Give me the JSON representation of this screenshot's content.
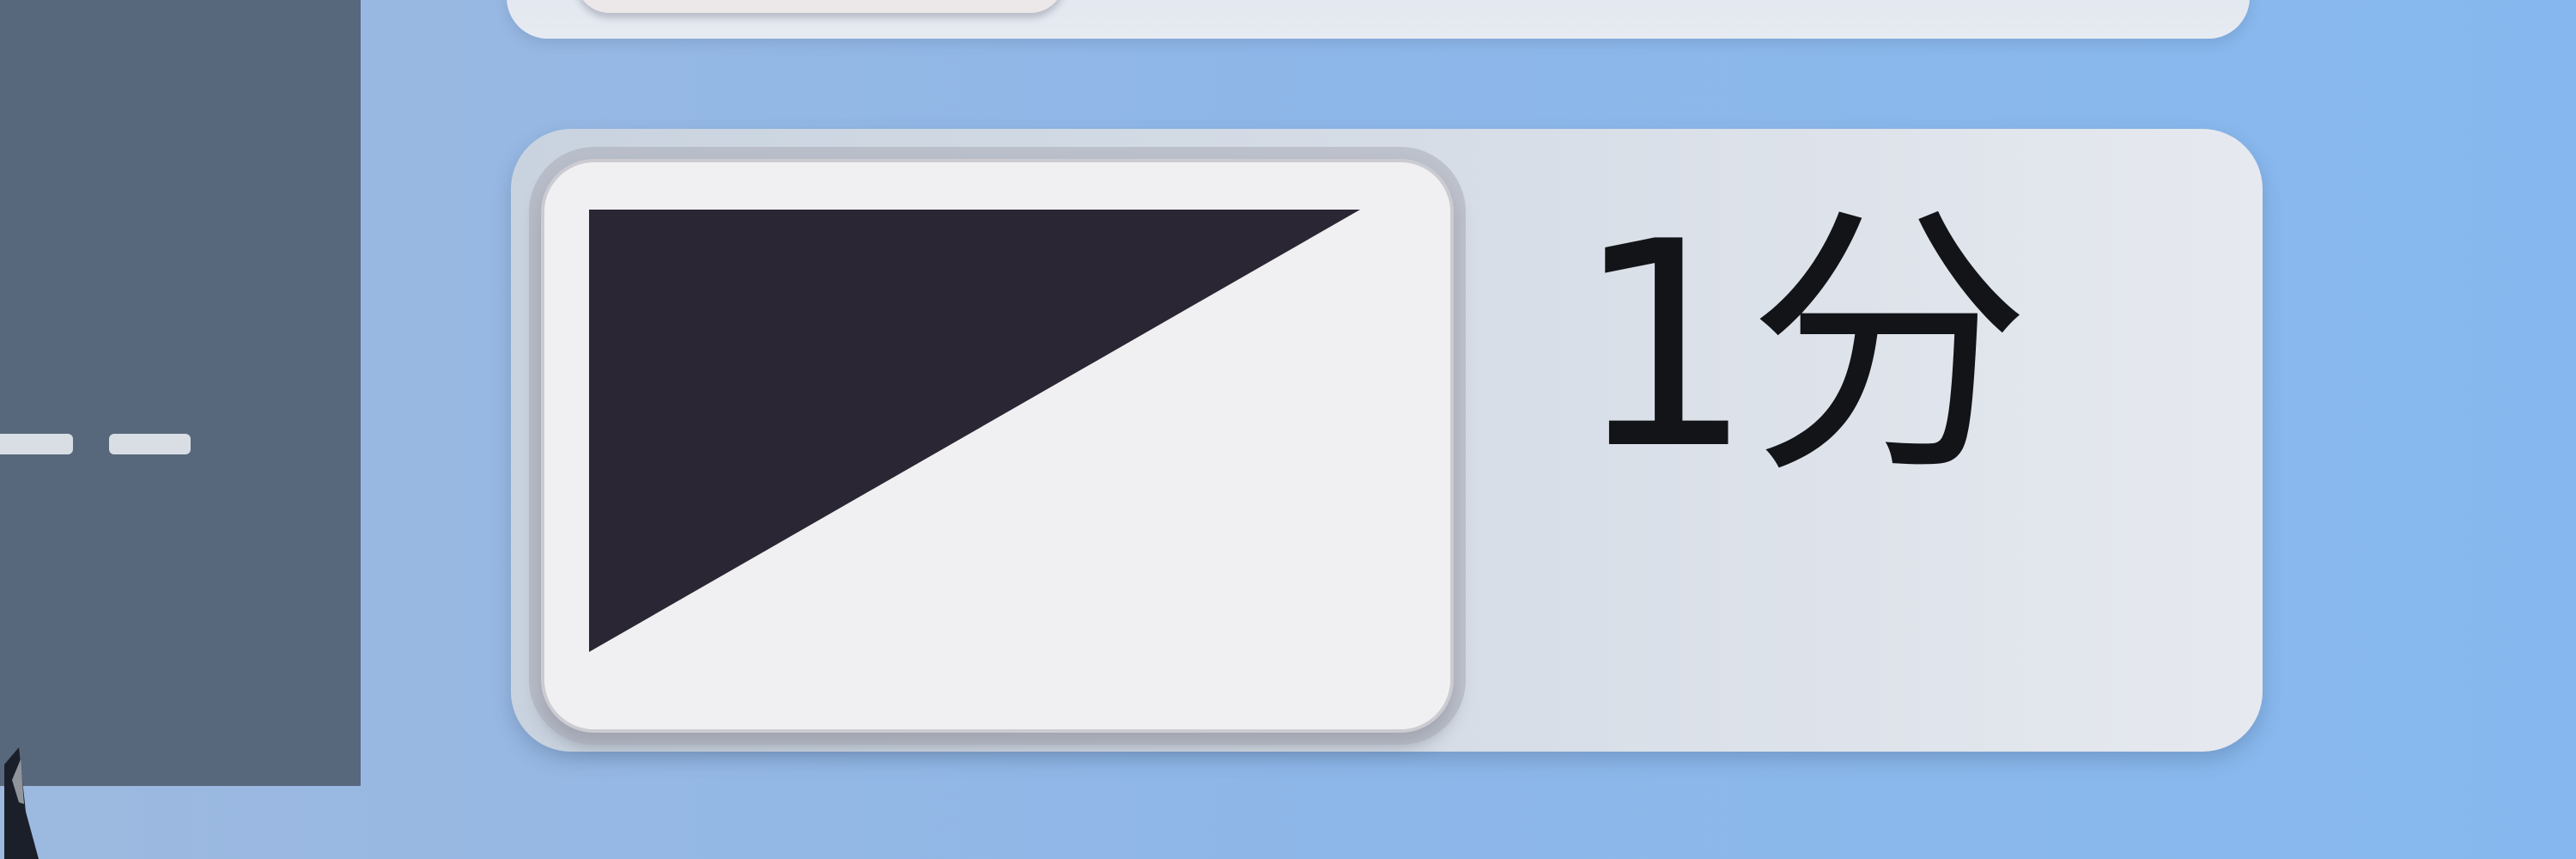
{
  "side_panel": {
    "placeholder_text": "- -"
  },
  "timer_item": {
    "duration_label": "1分"
  },
  "colors": {
    "background": "#8fb7e8",
    "side_panel": "#58687c",
    "row_background": "#d5dce6",
    "thumbnail_background": "#f0f0f2",
    "triangle_fill": "#2b2633",
    "text": "#121418"
  },
  "icons": {
    "thumbnail": "diagonal-split-icon",
    "cursor": "cursor-icon"
  }
}
